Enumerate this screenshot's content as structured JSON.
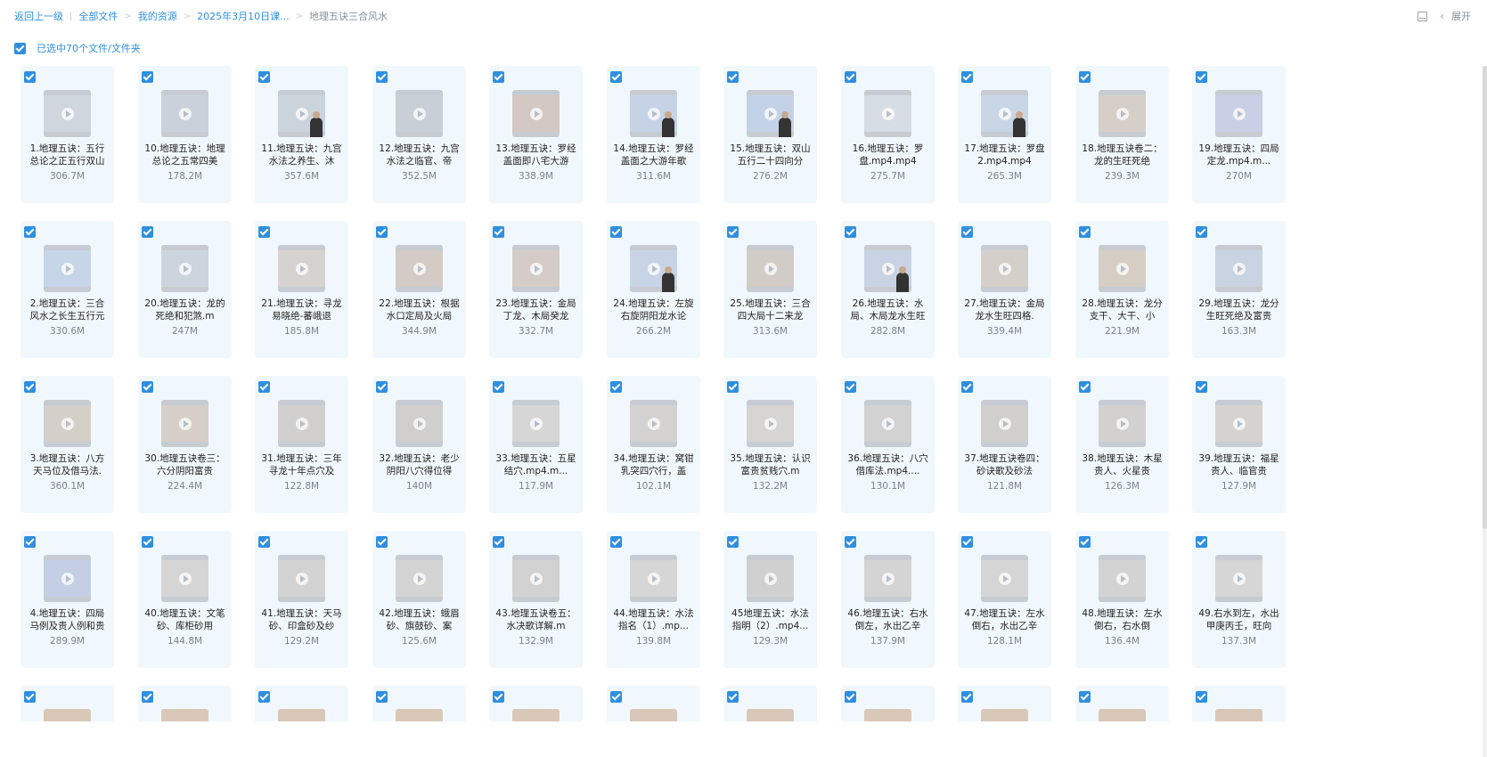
{
  "breadcrumb": {
    "back": "返回上一级",
    "items": [
      "全部文件",
      "我的资源",
      "2025年3月10日课...",
      "地理五诀三合风水"
    ]
  },
  "toolbar": {
    "expand_label": "展开"
  },
  "selection": {
    "label": "已选中70个文件/文件夹"
  },
  "files": [
    {
      "name": "1.地理五诀：五行总论之正五行双山",
      "size": "306.7M",
      "person": false,
      "tone": "#cfd6de"
    },
    {
      "name": "10.地理五诀：地理总论之五常四美",
      "size": "178.2M",
      "person": false,
      "tone": "#c9d2db"
    },
    {
      "name": "11.地理五诀：九宫水法之养生、沐",
      "size": "357.6M",
      "person": true,
      "tone": "#cbd3db"
    },
    {
      "name": "12.地理五诀：九宫水法之临官、帝",
      "size": "352.5M",
      "person": false,
      "tone": "#c8cfd7"
    },
    {
      "name": "13.地理五诀：罗经盖面即八宅大游",
      "size": "338.9M",
      "person": false,
      "tone": "#d3c9c2"
    },
    {
      "name": "14.地理五诀：罗经盖面之大游年歌",
      "size": "311.6M",
      "person": true,
      "tone": "#c6d3e6"
    },
    {
      "name": "15.地理五诀：双山五行二十四向分",
      "size": "276.2M",
      "person": true,
      "tone": "#c4d2e8"
    },
    {
      "name": "16.地理五诀：罗盘.mp4.mp4",
      "size": "275.7M",
      "person": false,
      "tone": "#d7dde4"
    },
    {
      "name": "17.地理五诀：罗盘2.mp4.mp4",
      "size": "265.3M",
      "person": true,
      "tone": "#c9d6e6"
    },
    {
      "name": "18.地理五诀卷二：龙的生旺死绝",
      "size": "239.3M",
      "person": false,
      "tone": "#d6cfc8"
    },
    {
      "name": "19.地理五诀：四局定龙.mp4.m...",
      "size": "270M",
      "person": false,
      "tone": "#c9cfe4"
    },
    {
      "name": "2.地理五诀：三合风水之长生五行元",
      "size": "330.6M",
      "person": false,
      "tone": "#c6d5e8"
    },
    {
      "name": "20.地理五诀：龙的死绝和犯煞.m",
      "size": "247M",
      "person": false,
      "tone": "#ccd5dd"
    },
    {
      "name": "21.地理五诀：寻龙易晓绝-蕃峨退",
      "size": "185.8M",
      "person": false,
      "tone": "#d5d2cf"
    },
    {
      "name": "22.地理五诀：根据水口定局及火局",
      "size": "344.9M",
      "person": false,
      "tone": "#d3ccc6"
    },
    {
      "name": "23.地理五诀：金局丁龙、木局癸龙",
      "size": "332.7M",
      "person": false,
      "tone": "#d4cdc7"
    },
    {
      "name": "24.地理五诀：左旋右旋阴阳龙水论",
      "size": "266.2M",
      "person": true,
      "tone": "#c8d4e6"
    },
    {
      "name": "25.地理五诀：三合四大局十二来龙",
      "size": "313.6M",
      "person": false,
      "tone": "#d2ccc7"
    },
    {
      "name": "26.地理五诀：水局、木局龙水生旺",
      "size": "282.8M",
      "person": true,
      "tone": "#c9d3e3"
    },
    {
      "name": "27.地理五诀：金局龙水生旺四格.",
      "size": "339.4M",
      "person": false,
      "tone": "#d5cfc9"
    },
    {
      "name": "28.地理五诀：龙分支干、大干、小",
      "size": "221.9M",
      "person": false,
      "tone": "#d6cdc5"
    },
    {
      "name": "29.地理五诀：龙分生旺死绝及富贵",
      "size": "163.3M",
      "person": false,
      "tone": "#cad3e2"
    },
    {
      "name": "3.地理五诀：八方天马位及借马法.",
      "size": "360.1M",
      "person": false,
      "tone": "#d5cfca"
    },
    {
      "name": "30.地理五诀卷三：六分阴阳富贵",
      "size": "224.4M",
      "person": false,
      "tone": "#d6cfc8"
    },
    {
      "name": "31.地理五诀：三年寻龙十年点穴及",
      "size": "122.8M",
      "person": false,
      "tone": "#d2d0ce"
    },
    {
      "name": "32.地理五诀：老少阴阳八穴得位得",
      "size": "140M",
      "person": false,
      "tone": "#d1cfcd"
    },
    {
      "name": "33.地理五诀：五星结穴.mp4.m...",
      "size": "117.9M",
      "person": false,
      "tone": "#d6d6d6"
    },
    {
      "name": "34.地理五诀：窝钳乳突四穴行，盖",
      "size": "102.1M",
      "person": false,
      "tone": "#d4d2d0"
    },
    {
      "name": "35.地理五诀：认识富贵贫贱穴.m",
      "size": "132.2M",
      "person": false,
      "tone": "#d7d4d1"
    },
    {
      "name": "36.地理五诀：八穴借库法.mp4....",
      "size": "130.1M",
      "person": false,
      "tone": "#d2d2d2"
    },
    {
      "name": "37.地理五诀卷四：砂诀歌及砂法",
      "size": "121.8M",
      "person": false,
      "tone": "#d1cfcc"
    },
    {
      "name": "38.地理五诀：木星贵人、火星贵",
      "size": "126.3M",
      "person": false,
      "tone": "#d3d1cf"
    },
    {
      "name": "39.地理五诀：福星贵人、临官贵",
      "size": "127.9M",
      "person": false,
      "tone": "#d5d3d1"
    },
    {
      "name": "4.地理五诀：四局马例及贵人例和贵",
      "size": "289.9M",
      "person": false,
      "tone": "#c4cfe6"
    },
    {
      "name": "40.地理五诀：文笔砂、库柜砂用",
      "size": "144.8M",
      "person": false,
      "tone": "#d5d5d5"
    },
    {
      "name": "41.地理五诀：天马砂、印盒砂及纱",
      "size": "129.2M",
      "person": false,
      "tone": "#d3d3d3"
    },
    {
      "name": "42.地理五诀：蛾眉砂、旗鼓砂、案",
      "size": "125.6M",
      "person": false,
      "tone": "#d4d4d4"
    },
    {
      "name": "43.地理五诀卷五：水决歌详解.m",
      "size": "132.9M",
      "person": false,
      "tone": "#d2d2d2"
    },
    {
      "name": "44.地理五诀：水法指名（1）.mp...",
      "size": "139.8M",
      "person": false,
      "tone": "#d6d6d6"
    },
    {
      "name": "45地理五诀：水法指明（2）.mp4...",
      "size": "129.3M",
      "person": false,
      "tone": "#d0d0d0"
    },
    {
      "name": "46.地理五诀：右水倒左，水出乙辛",
      "size": "137.9M",
      "person": false,
      "tone": "#d4d4d4"
    },
    {
      "name": "47.地理五诀：左水倒右，水出乙辛",
      "size": "128.1M",
      "person": false,
      "tone": "#d5d5d5"
    },
    {
      "name": "48.地理五诀：左水倒右，右水倒",
      "size": "136.4M",
      "person": false,
      "tone": "#d3d3d3"
    },
    {
      "name": "49.右水到左，水出甲庚丙壬，旺向",
      "size": "137.3M",
      "person": false,
      "tone": "#d6d6d6"
    }
  ],
  "partial_row_count": 11
}
